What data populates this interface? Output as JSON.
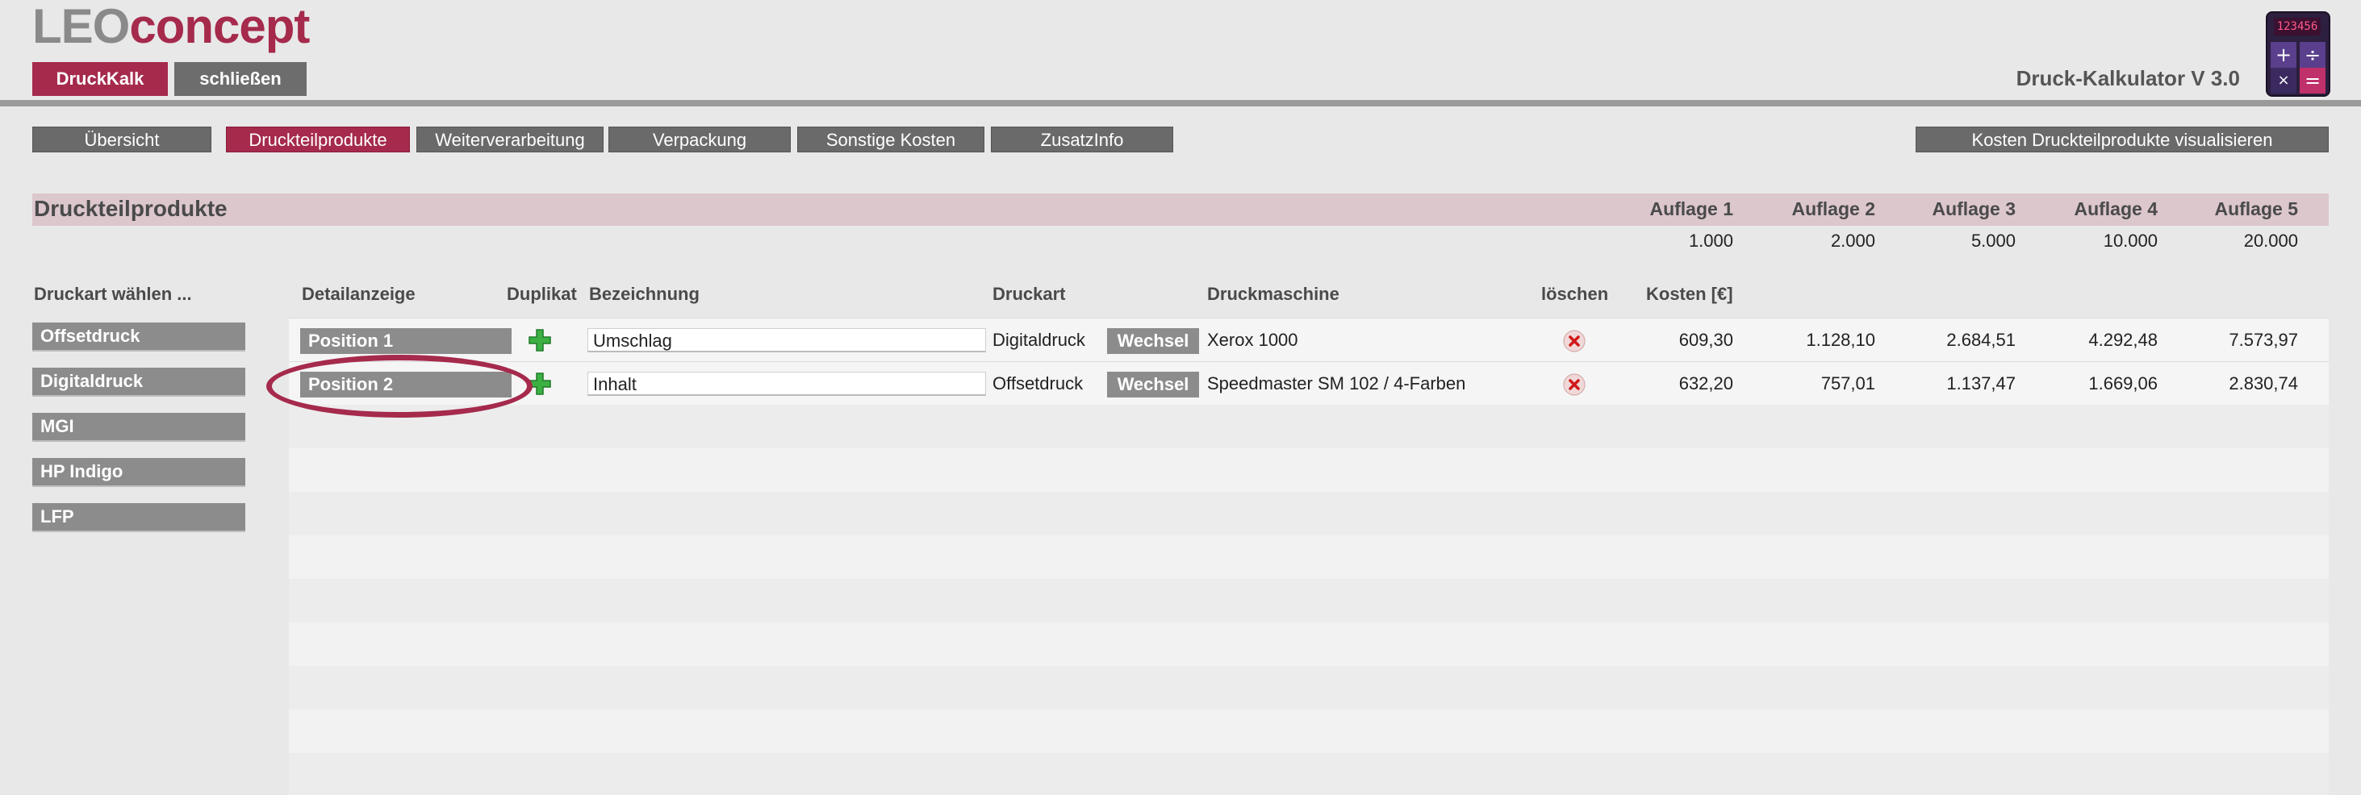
{
  "app": {
    "logo_part1": "LEO",
    "logo_part2": "concept",
    "title": "Druck-Kalkulator V 3.0",
    "calc_display": "123456"
  },
  "top_buttons": {
    "druckkalk": "DruckKalk",
    "schliessen": "schließen"
  },
  "tabs": [
    {
      "label": "Übersicht"
    },
    {
      "label": "Druckteilprodukte",
      "active": true
    },
    {
      "label": "Weiterverarbeitung"
    },
    {
      "label": "Verpackung"
    },
    {
      "label": "Sonstige Kosten"
    },
    {
      "label": "ZusatzInfo"
    }
  ],
  "visualize_button": "Kosten Druckteilprodukte visualisieren",
  "section": {
    "title": "Druckteilprodukte",
    "auflagen": [
      {
        "label": "Auflage 1",
        "value": "1.000"
      },
      {
        "label": "Auflage 2",
        "value": "2.000"
      },
      {
        "label": "Auflage 3",
        "value": "5.000"
      },
      {
        "label": "Auflage 4",
        "value": "10.000"
      },
      {
        "label": "Auflage 5",
        "value": "20.000"
      }
    ]
  },
  "columns": {
    "druckart_waehlen": "Druckart wählen ...",
    "detailanzeige": "Detailanzeige",
    "duplikat": "Duplikat",
    "bezeichnung": "Bezeichnung",
    "druckart": "Druckart",
    "druckmaschine": "Druckmaschine",
    "loeschen": "löschen",
    "kosten": "Kosten [€]"
  },
  "print_types": [
    "Offsetdruck",
    "Digitaldruck",
    "MGI",
    "HP Indigo",
    "LFP"
  ],
  "rows": [
    {
      "position": "Position 1",
      "bezeichnung": "Umschlag",
      "druckart": "Digitaldruck",
      "wechsel": "Wechsel",
      "druckmaschine": "Xerox 1000",
      "kosten": [
        "609,30",
        "1.128,10",
        "2.684,51",
        "4.292,48",
        "7.573,97"
      ]
    },
    {
      "position": "Position 2",
      "bezeichnung": "Inhalt",
      "druckart": "Offsetdruck",
      "wechsel": "Wechsel",
      "druckmaschine": "Speedmaster SM 102 / 4-Farben",
      "kosten": [
        "632,20",
        "757,01",
        "1.137,47",
        "1.669,06",
        "2.830,74"
      ]
    }
  ],
  "colors": {
    "accent": "#a52a4c",
    "button_gray": "#6a6a6a",
    "band": "#dcc7cd"
  }
}
